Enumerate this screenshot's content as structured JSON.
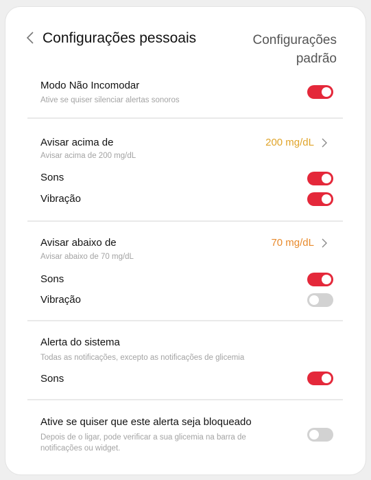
{
  "header": {
    "title": "Configurações pessoais",
    "reset_label": "Configurações padrão"
  },
  "dnd": {
    "label": "Modo Não Incomodar",
    "sub": "Ative se quiser silenciar alertas sonoros",
    "on": true
  },
  "high": {
    "label": "Avisar acima de",
    "value": "200 mg/dL",
    "value_color": "#e0a42a",
    "sub": "Avisar acima de 200 mg/dL",
    "sounds_label": "Sons",
    "sounds_on": true,
    "vibration_label": "Vibração",
    "vibration_on": true
  },
  "low": {
    "label": "Avisar abaixo de",
    "value": "70 mg/dL",
    "value_color": "#e88a2c",
    "sub": "Avisar abaixo de 70 mg/dL",
    "sounds_label": "Sons",
    "sounds_on": true,
    "vibration_label": "Vibração",
    "vibration_on": false
  },
  "system": {
    "label": "Alerta do sistema",
    "sub": "Todas as notificações, excepto as notificações de glicemia",
    "sounds_label": "Sons",
    "sounds_on": true
  },
  "lock": {
    "label": "Ative se quiser que este alerta seja bloqueado",
    "sub": "Depois de o ligar, pode verificar a sua glicemia na barra de notificações ou widget.",
    "on": false
  },
  "colors": {
    "toggle_on": "#e4283a",
    "toggle_off": "#d2d2d2"
  }
}
